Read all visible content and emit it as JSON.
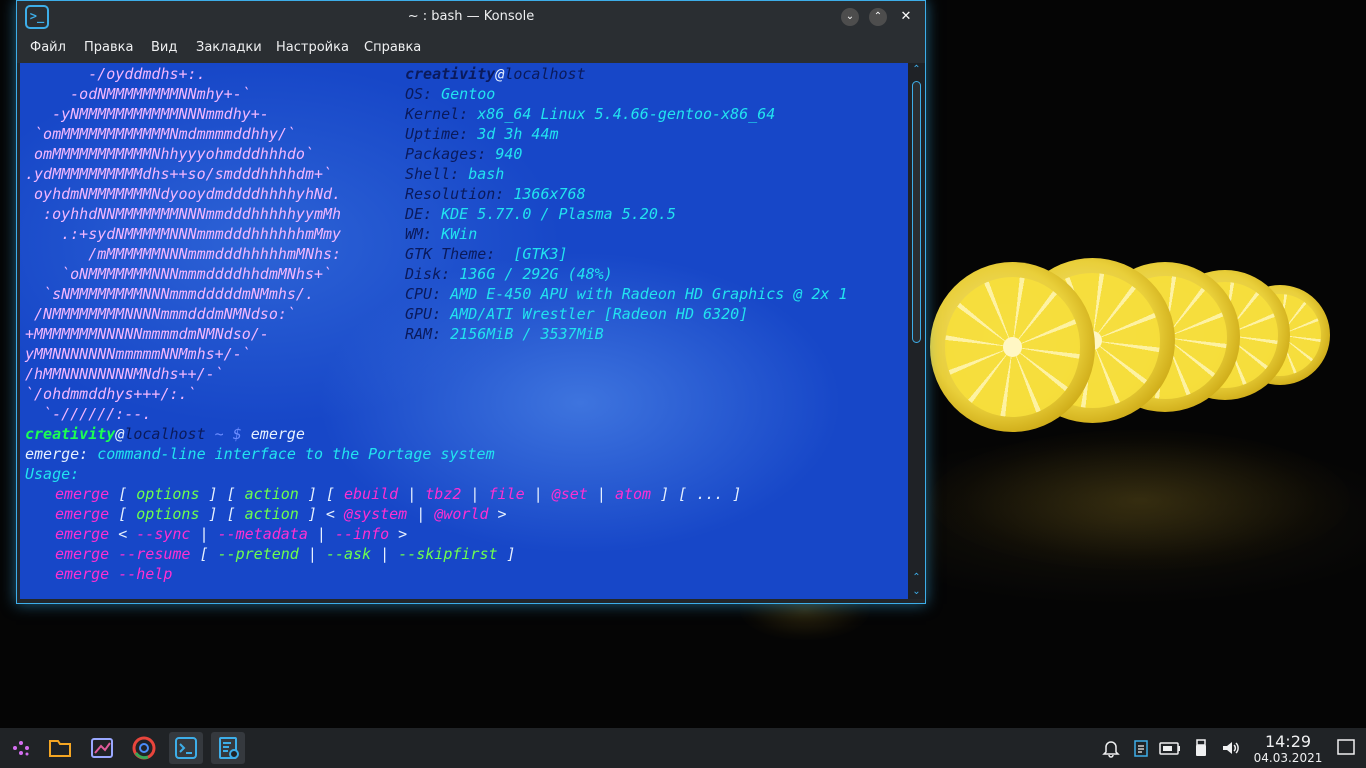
{
  "window": {
    "title": "~ : bash — Konsole",
    "minimize": "⌄",
    "maximize": "⌃",
    "close": "✕"
  },
  "menu": [
    "Файл",
    "Правка",
    "Вид",
    "Закладки",
    "Настройка",
    "Справка"
  ],
  "logo": [
    "       -/oyddmdhs+:.",
    "     -odNMMMMMMMMNNmhy+-`",
    "   -yNMMMMMMMMMMMNNNmmdhy+-",
    " `omMMMMMMMMMMMMNmdmmmmddhhy/`",
    " omMMMMMMMMMMMNhhyyyohmdddhhhdo`",
    ".ydMMMMMMMMMMdhs++so/smdddhhhhdm+`",
    " oyhdmNMMMMMMMNdyooydmddddhhhhyhNd.",
    "  :oyhhdNNMMMMMMMNNNmmdddhhhhhyymMh",
    "    .:+sydNMMMMMNNNmmmdddhhhhhhmMmy",
    "       /mMMMMMMNNNmmmdddhhhhhmMNhs:",
    "    `oNMMMMMMMNNNmmmddddhhdmMNhs+`",
    "  `sNMMMMMMMMNNNmmmdddddmNMmhs/.",
    " /NMMMMMMMMNNNNmmmdddmNMNdso:`",
    "+MMMMMMMNNNNNmmmmdmNMNdso/-",
    "yMMNNNNNNNmmmmmNNMmhs+/-`",
    "/hMMNNNNNNNNMNdhs++/-`",
    "`/ohdmmddhys+++/:.`",
    "  `-//////:--."
  ],
  "info": {
    "user": "creativity",
    "at": "@",
    "host": "localhost",
    "fields": [
      {
        "label": "OS:",
        "value": "Gentoo"
      },
      {
        "label": "Kernel:",
        "value": "x86_64 Linux 5.4.66-gentoo-x86_64"
      },
      {
        "label": "Uptime:",
        "value": "3d 3h 44m"
      },
      {
        "label": "Packages:",
        "value": "940"
      },
      {
        "label": "Shell:",
        "value": "bash"
      },
      {
        "label": "Resolution:",
        "value": "1366x768"
      },
      {
        "label": "DE:",
        "value": "KDE 5.77.0 / Plasma 5.20.5"
      },
      {
        "label": "WM:",
        "value": "KWin"
      },
      {
        "label": "GTK Theme:",
        "value": " [GTK3]"
      },
      {
        "label": "Disk:",
        "value": "136G / 292G (48%)"
      },
      {
        "label": "CPU:",
        "value": "AMD E-450 APU with Radeon HD Graphics @ 2x 1"
      },
      {
        "label": "GPU:",
        "value": "AMD/ATI Wrestler [Radeon HD 6320]"
      },
      {
        "label": "RAM:",
        "value": "2156MiB / 3537MiB"
      }
    ]
  },
  "prompt": {
    "user": "creativity",
    "at": "@",
    "host": "localhost",
    "path": " ~ ",
    "sign": "$",
    "command": " emerge"
  },
  "output": {
    "desc_cmd": "emerge:",
    "desc_text": " command-line interface to the Portage system",
    "usage": "Usage:",
    "lines": [
      [
        [
          "m",
          "emerge "
        ],
        [
          "w",
          "[ "
        ],
        [
          "g",
          "options"
        ],
        [
          "w",
          " ] [ "
        ],
        [
          "g",
          "action"
        ],
        [
          "w",
          " ] [ "
        ],
        [
          "m",
          "ebuild"
        ],
        [
          "w",
          " | "
        ],
        [
          "m",
          "tbz2"
        ],
        [
          "w",
          " | "
        ],
        [
          "m",
          "file"
        ],
        [
          "w",
          " | "
        ],
        [
          "m",
          "@set"
        ],
        [
          "w",
          " | "
        ],
        [
          "m",
          "atom"
        ],
        [
          "w",
          " ] [ ... ]"
        ]
      ],
      [
        [
          "m",
          "emerge "
        ],
        [
          "w",
          "[ "
        ],
        [
          "g",
          "options"
        ],
        [
          "w",
          " ] [ "
        ],
        [
          "g",
          "action"
        ],
        [
          "w",
          " ] < "
        ],
        [
          "m",
          "@system"
        ],
        [
          "w",
          " | "
        ],
        [
          "m",
          "@world"
        ],
        [
          "w",
          " >"
        ]
      ],
      [
        [
          "m",
          "emerge "
        ],
        [
          "w",
          "< "
        ],
        [
          "m",
          "--sync"
        ],
        [
          "w",
          " | "
        ],
        [
          "m",
          "--metadata"
        ],
        [
          "w",
          " | "
        ],
        [
          "m",
          "--info"
        ],
        [
          "w",
          " >"
        ]
      ],
      [
        [
          "m",
          "emerge "
        ],
        [
          "m",
          "--resume"
        ],
        [
          "w",
          " [ "
        ],
        [
          "g",
          "--pretend"
        ],
        [
          "w",
          " | "
        ],
        [
          "g",
          "--ask"
        ],
        [
          "w",
          " | "
        ],
        [
          "g",
          "--skipfirst"
        ],
        [
          "w",
          " ]"
        ]
      ],
      [
        [
          "m",
          "emerge "
        ],
        [
          "m",
          "--help"
        ]
      ]
    ]
  },
  "clock": {
    "time": "14:29",
    "date": "04.03.2021"
  },
  "taskbar": {
    "launcher": "launcher-icon",
    "tasks": [
      "folder-icon",
      "pen-app-icon",
      "chrome-icon",
      "konsole-icon",
      "task-manager-icon"
    ],
    "tray": [
      "bell-icon",
      "clipboard-icon",
      "battery-icon",
      "usb-icon",
      "volume-icon"
    ]
  },
  "colors": {
    "accent": "#3daee9",
    "terminal_bg": "#1747c8"
  }
}
